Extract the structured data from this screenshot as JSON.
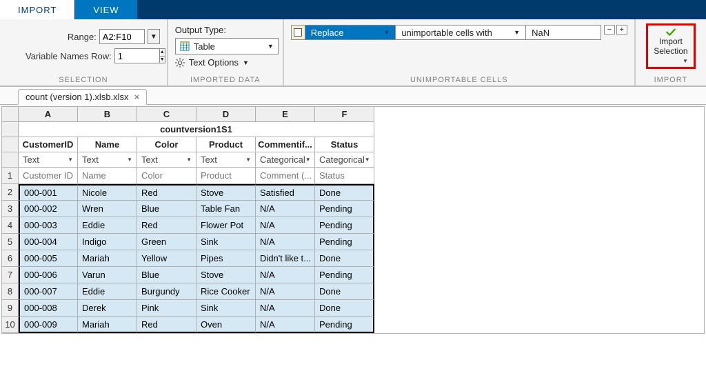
{
  "ribbon": {
    "tabs": [
      {
        "label": "IMPORT",
        "active": true
      },
      {
        "label": "VIEW",
        "active": false
      }
    ]
  },
  "selection": {
    "range_label": "Range:",
    "range_value": "A2:F10",
    "varnames_label": "Variable Names Row:",
    "varnames_value": "1",
    "group_label": "SELECTION"
  },
  "imported": {
    "output_type_label": "Output Type:",
    "output_type_value": "Table",
    "text_options_label": "Text Options",
    "group_label": "IMPORTED DATA"
  },
  "unimportable": {
    "rule_action": "Replace",
    "rule_text": "unimportable cells with",
    "rule_value": "NaN",
    "group_label": "UNIMPORTABLE CELLS"
  },
  "import_button": {
    "label": "Import\nSelection",
    "group_label": "IMPORT"
  },
  "file_tab": "count (version 1).xlsb.xlsx",
  "sheet": {
    "col_letters": [
      "A",
      "B",
      "C",
      "D",
      "E",
      "F"
    ],
    "merged_title": "countversion1S1",
    "var_names": [
      "CustomerID",
      "Name",
      "Color",
      "Product",
      "Commentif...",
      "Status"
    ],
    "types": [
      "Text",
      "Text",
      "Text",
      "Text",
      "Categorical",
      "Categorical"
    ],
    "header_row": [
      "Customer ID",
      "Name",
      "Color",
      "Product",
      "Comment (...",
      "Status"
    ],
    "rows": [
      [
        "000-001",
        "Nicole",
        "Red",
        "Stove",
        "Satisfied",
        "Done"
      ],
      [
        "000-002",
        "Wren",
        "Blue",
        "Table Fan",
        "N/A",
        "Pending"
      ],
      [
        "000-003",
        "Eddie",
        "Red",
        "Flower Pot",
        "N/A",
        "Pending"
      ],
      [
        "000-004",
        "Indigo",
        "Green",
        "Sink",
        "N/A",
        "Pending"
      ],
      [
        "000-005",
        "Mariah",
        "Yellow",
        "Pipes",
        "Didn't like t...",
        "Done"
      ],
      [
        "000-006",
        "Varun",
        "Blue",
        "Stove",
        "N/A",
        "Pending"
      ],
      [
        "000-007",
        "Eddie",
        "Burgundy",
        "Rice Cooker",
        "N/A",
        "Done"
      ],
      [
        "000-008",
        "Derek",
        "Pink",
        "Sink",
        "N/A",
        "Done"
      ],
      [
        "000-009",
        "Mariah",
        "Red",
        "Oven",
        "N/A",
        "Pending"
      ]
    ]
  }
}
